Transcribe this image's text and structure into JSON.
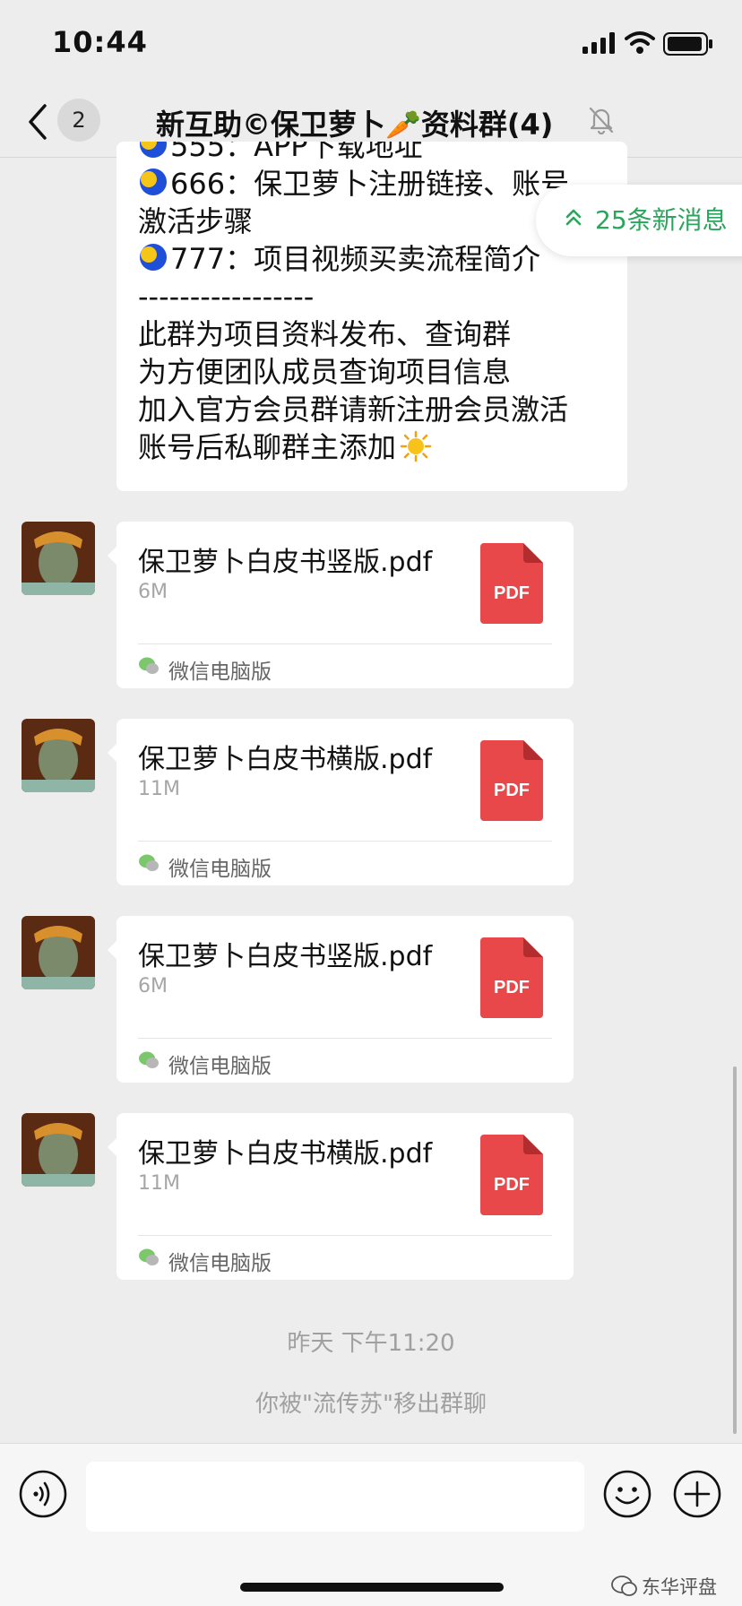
{
  "status_bar": {
    "time": "10:44"
  },
  "nav": {
    "unread_count": "2",
    "title": "新互助©保卫萝卜🥕资料群(4)"
  },
  "new_messages_pill": {
    "label": "25条新消息"
  },
  "text_message": {
    "line_partial": "555：APP下载地址",
    "line_666": "666：保卫萝卜注册链接、账号",
    "line_666b": "激活步骤",
    "line_777": "777：项目视频买卖流程简介",
    "divider": "-----------------",
    "body_1": "此群为项目资料发布、查询群",
    "body_2": "为方便团队成员查询项目信息",
    "body_3": "加入官方会员群请新注册会员激活",
    "body_4": "账号后私聊群主添加"
  },
  "file_messages": [
    {
      "name": "保卫萝卜白皮书竖版.pdf",
      "size": "6M",
      "source": "微信电脑版",
      "type_label": "PDF"
    },
    {
      "name": "保卫萝卜白皮书横版.pdf",
      "size": "11M",
      "source": "微信电脑版",
      "type_label": "PDF"
    },
    {
      "name": "保卫萝卜白皮书竖版.pdf",
      "size": "6M",
      "source": "微信电脑版",
      "type_label": "PDF"
    },
    {
      "name": "保卫萝卜白皮书横版.pdf",
      "size": "11M",
      "source": "微信电脑版",
      "type_label": "PDF"
    }
  ],
  "system": {
    "timestamp": "昨天 下午11:20",
    "notice": "你被\"流传苏\"移出群聊"
  },
  "watermark": {
    "text": "东华评盘"
  },
  "colors": {
    "background": "#ededed",
    "accent_green": "#2aa55c",
    "pdf_red": "#e8484a",
    "bubble": "#ffffff"
  },
  "icons": {
    "back": "chevron-left-icon",
    "mute": "bell-slash-icon",
    "emoji_moon": "moon-face-icon",
    "emoji_sun": "sun-face-icon",
    "file": "pdf-file-icon",
    "voice": "voice-icon",
    "emoji": "emoji-icon",
    "more": "plus-icon"
  }
}
